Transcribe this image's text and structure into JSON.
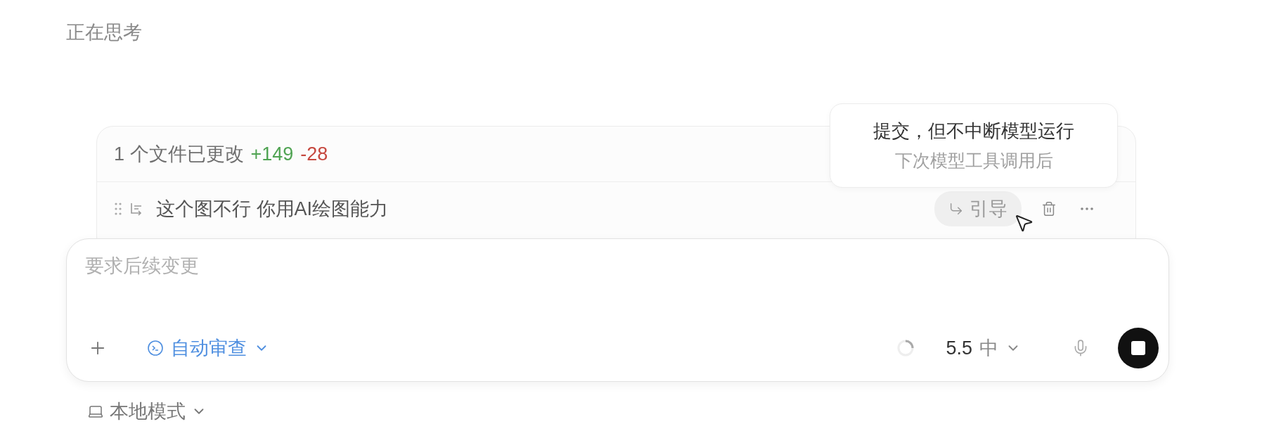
{
  "status": "正在思考",
  "changes": {
    "summary": "1 个文件已更改",
    "added": "+149",
    "removed": "-28"
  },
  "queued": [
    {
      "text": "这个图不行 你用AI绘图能力",
      "steer_label": "引导",
      "hovered": true
    }
  ],
  "tooltip": {
    "title": "提交，但不中断模型运行",
    "subtitle": "下次模型工具调用后"
  },
  "composer": {
    "placeholder": "要求后续变更",
    "review_mode": "自动审查",
    "model": "5.5",
    "effort": "中"
  },
  "mode": "本地模式"
}
